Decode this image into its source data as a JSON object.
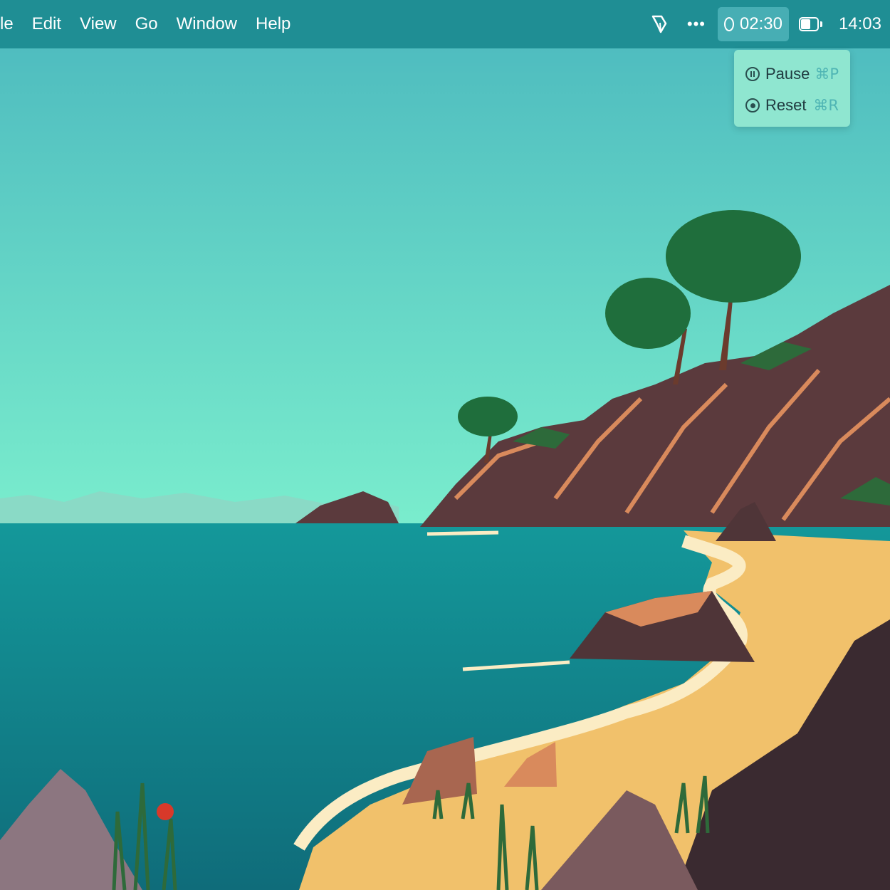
{
  "menubar": {
    "background": "#1f8e94",
    "menus": [
      {
        "label": "le"
      },
      {
        "label": "Edit"
      },
      {
        "label": "View"
      },
      {
        "label": "Go"
      },
      {
        "label": "Window"
      },
      {
        "label": "Help"
      }
    ],
    "status": {
      "pen_icon": "pen-nib-icon",
      "more_icon": "more-dots-icon",
      "more_text": "•••",
      "timer": {
        "icon": "timer-ring-icon",
        "value": "02:30"
      },
      "battery_icon": "battery-icon",
      "battery_level_fraction": 0.6,
      "clock": "14:03"
    }
  },
  "timer_menu": {
    "background": "#8fe6d0",
    "items": [
      {
        "icon": "pause-circle-icon",
        "label": "Pause",
        "shortcut": "⌘P"
      },
      {
        "icon": "stop-circle-icon",
        "label": "Reset",
        "shortcut": "⌘R"
      }
    ]
  },
  "wallpaper": {
    "scene": "beach-cove-illustration",
    "colors": {
      "sky_top": "#4bb8be",
      "sky_bottom": "#7aedcd",
      "sea": "#137f86",
      "sand": "#f1c16b",
      "rock": "#5b3a3d",
      "tree": "#1f6e3c"
    }
  }
}
